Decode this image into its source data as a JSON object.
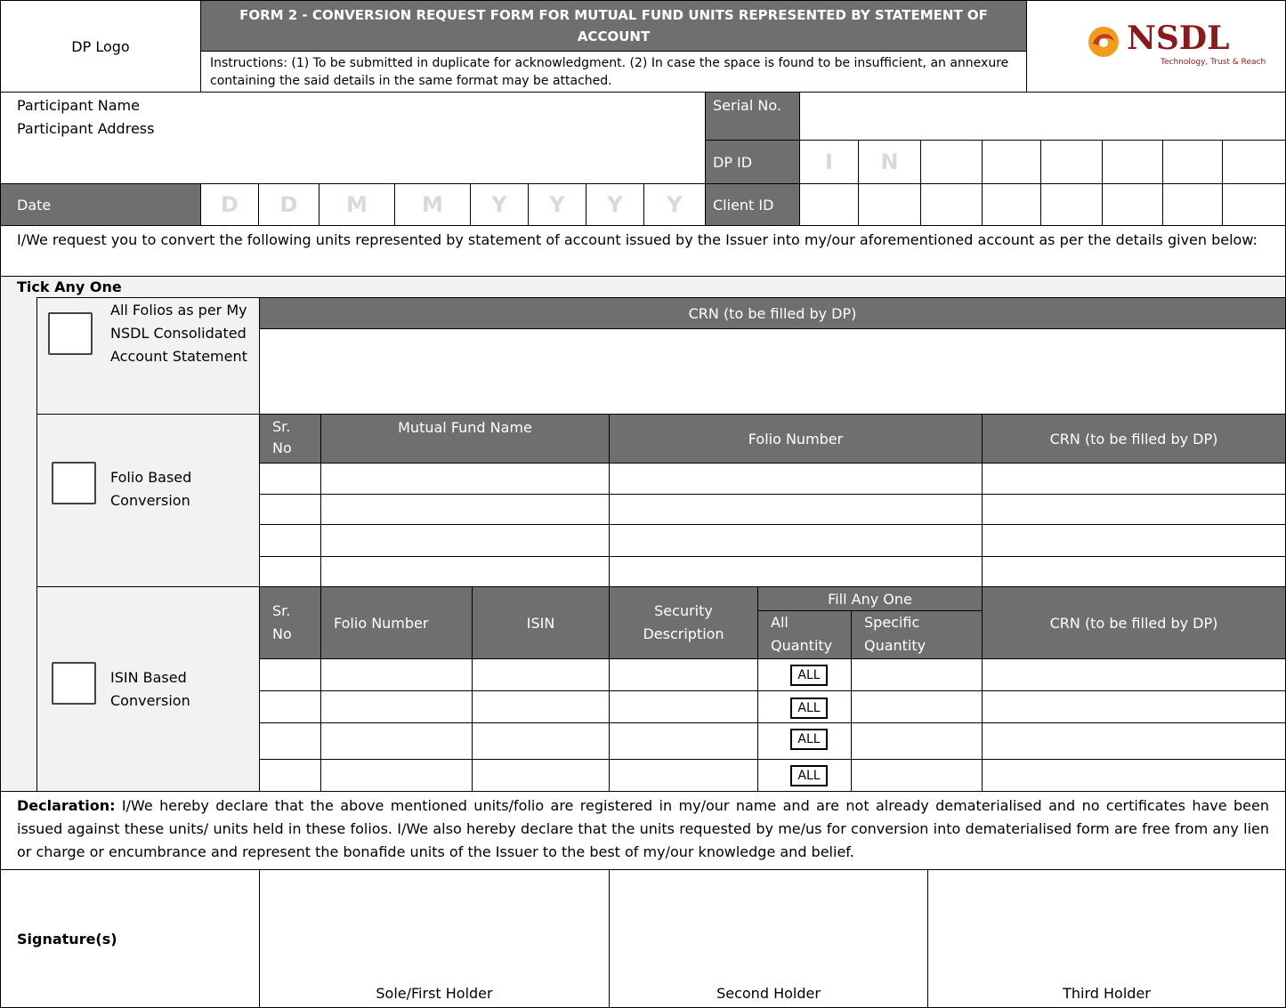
{
  "header": {
    "dp_logo": "DP Logo",
    "title": "FORM 2 - CONVERSION REQUEST FORM FOR MUTUAL FUND UNITS REPRESENTED BY STATEMENT OF ACCOUNT",
    "instructions": "Instructions: (1) To be submitted in duplicate for acknowledgment. (2) In case the space is found to be insufficient, an annexure containing the said details in the same format may be attached.",
    "logo_text": "NSDL",
    "logo_tagline": "Technology, Trust & Reach",
    "brand_color": "#8b1a1a"
  },
  "participant": {
    "name_label": "Participant Name",
    "address_label": "Participant Address",
    "serial_label": "Serial No.",
    "dpid_label": "DP ID",
    "dpid_prefix": [
      "I",
      "N"
    ],
    "client_label": "Client ID"
  },
  "date": {
    "label": "Date",
    "placeholders": [
      "D",
      "D",
      "M",
      "M",
      "Y",
      "Y",
      "Y",
      "Y"
    ]
  },
  "request_text": "I/We request you to convert the following units represented by statement of account issued by the Issuer into my/our aforementioned account as per the details given below:",
  "tick_label": "Tick Any One",
  "option_all": {
    "label": "All Folios as per My NSDL Consolidated Account Statement",
    "crn_header": "CRN (to be filled by DP)"
  },
  "option_folio": {
    "label": "Folio Based Conversion",
    "headers": [
      "Sr. No",
      "Mutual Fund Name",
      "Folio Number",
      "CRN (to be filled by DP)"
    ]
  },
  "option_isin": {
    "label": "ISIN Based Conversion",
    "headers": {
      "sr": "Sr. No",
      "folio": "Folio Number",
      "isin": "ISIN",
      "security": "Security Description",
      "fill_any": "Fill Any One",
      "all_qty": "All Quantity",
      "specific_qty": "Specific Quantity",
      "crn": "CRN (to be filled by DP)"
    },
    "all_badge": "ALL"
  },
  "declaration": {
    "heading": "Declaration:",
    "text": " I/We hereby declare that the above mentioned units/folio are registered in my/our name and are not already dematerialised and no certificates have been issued against these units/ units held in these folios. I/We also hereby declare that the units requested by me/us for conversion into dematerialised form are free from any lien or charge or encumbrance and represent the bonafide units of the Issuer to the best of my/our knowledge and belief."
  },
  "signatures": {
    "label": "Signature(s)",
    "holders": [
      "Sole/First Holder",
      "Second Holder",
      "Third Holder"
    ]
  }
}
